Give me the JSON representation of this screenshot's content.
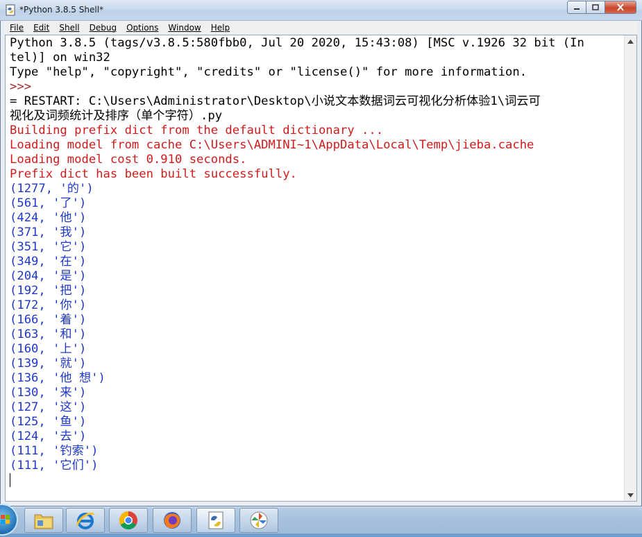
{
  "window": {
    "title": "*Python 3.8.5 Shell*"
  },
  "menu": [
    "File",
    "Edit",
    "Shell",
    "Debug",
    "Options",
    "Window",
    "Help"
  ],
  "shell": {
    "lines": [
      {
        "text": "Python 3.8.5 (tags/v3.8.5:580fbb0, Jul 20 2020, 15:43:08) [MSC v.1926 32 bit (In",
        "style": "normal"
      },
      {
        "text": "tel)] on win32",
        "style": "normal"
      },
      {
        "text": "Type \"help\", \"copyright\", \"credits\" or \"license()\" for more information.",
        "style": "normal"
      },
      {
        "text": ">>> ",
        "style": "prompt"
      },
      {
        "text": "= RESTART: C:\\Users\\Administrator\\Desktop\\小说文本数据词云可视化分析体验1\\词云可",
        "style": "normal"
      },
      {
        "text": "视化及词频统计及排序（单个字符）.py",
        "style": "normal"
      },
      {
        "text": "Building prefix dict from the default dictionary ...",
        "style": "red"
      },
      {
        "text": "Loading model from cache C:\\Users\\ADMINI~1\\AppData\\Local\\Temp\\jieba.cache",
        "style": "red"
      },
      {
        "text": "Loading model cost 0.910 seconds.",
        "style": "red"
      },
      {
        "text": "Prefix dict has been built successfully.",
        "style": "red"
      },
      {
        "text": "(1277, '的')",
        "style": "blue"
      },
      {
        "text": "(561, '了')",
        "style": "blue"
      },
      {
        "text": "(424, '他')",
        "style": "blue"
      },
      {
        "text": "(371, '我')",
        "style": "blue"
      },
      {
        "text": "(351, '它')",
        "style": "blue"
      },
      {
        "text": "(349, '在')",
        "style": "blue"
      },
      {
        "text": "(204, '是')",
        "style": "blue"
      },
      {
        "text": "(192, '把')",
        "style": "blue"
      },
      {
        "text": "(172, '你')",
        "style": "blue"
      },
      {
        "text": "(166, '着')",
        "style": "blue"
      },
      {
        "text": "(163, '和')",
        "style": "blue"
      },
      {
        "text": "(160, '上')",
        "style": "blue"
      },
      {
        "text": "(139, '就')",
        "style": "blue"
      },
      {
        "text": "(136, '他 想')",
        "style": "blue"
      },
      {
        "text": "(130, '来')",
        "style": "blue"
      },
      {
        "text": "(127, '这')",
        "style": "blue"
      },
      {
        "text": "(125, '鱼')",
        "style": "blue"
      },
      {
        "text": "(124, '去')",
        "style": "blue"
      },
      {
        "text": "(111, '钓索')",
        "style": "blue"
      },
      {
        "text": "(111, '它们')",
        "style": "blue"
      }
    ]
  },
  "taskbar": {
    "apps": [
      "file-explorer-icon",
      "internet-explorer-icon",
      "chrome-icon",
      "firefox-icon",
      "python-idle-icon",
      "pinwheel-app-icon"
    ]
  },
  "colors": {
    "stdout_blue": "#1e38c8",
    "stderr_red": "#d11b1b",
    "prompt": "#a02a2a"
  }
}
